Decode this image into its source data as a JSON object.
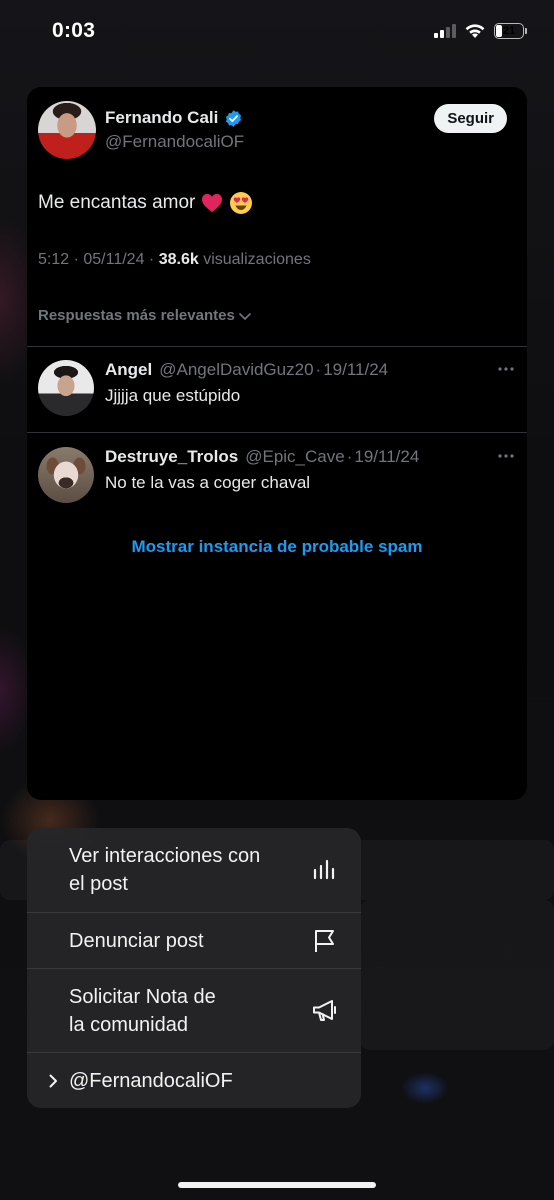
{
  "status_bar": {
    "time": "0:03",
    "battery": "21",
    "battery_fraction": 0.21
  },
  "tweet": {
    "author_name": "Fernando Cali",
    "author_handle": "@FernandocaliOF",
    "follow_label": "Seguir",
    "text": "Me encantas amor",
    "emojis": [
      "red-heart",
      "heart-eyes-face"
    ],
    "time": "5:12",
    "date": "05/11/24",
    "views_count": "38.6k",
    "views_label": "visualizaciones",
    "sort_label": "Respuestas más relevantes"
  },
  "replies": [
    {
      "name": "Angel",
      "handle": "@AngelDavidGuz20",
      "date": "19/11/24",
      "text": "Jjjjja que estúpido"
    },
    {
      "name": "Destruye_Trolos",
      "handle": "@Epic_Cave",
      "date": "19/11/24",
      "text": "No te la vas a coger chaval"
    }
  ],
  "spam_link": "Mostrar instancia de probable spam",
  "menu": {
    "view_interactions": {
      "line1": "Ver interacciones con",
      "line2": "el post",
      "icon": "bar-chart-icon"
    },
    "report": {
      "label": "Denunciar post",
      "icon": "flag-icon"
    },
    "community_note": {
      "line1": "Solicitar Nota de",
      "line2": "la comunidad",
      "icon": "megaphone-icon"
    },
    "profile": {
      "label": "@FernandocaliOF",
      "icon": "chevron-right-icon"
    }
  },
  "colors": {
    "accent": "#1d9bf0",
    "verified": "#1d9bf0",
    "heart": "#e0245e"
  }
}
